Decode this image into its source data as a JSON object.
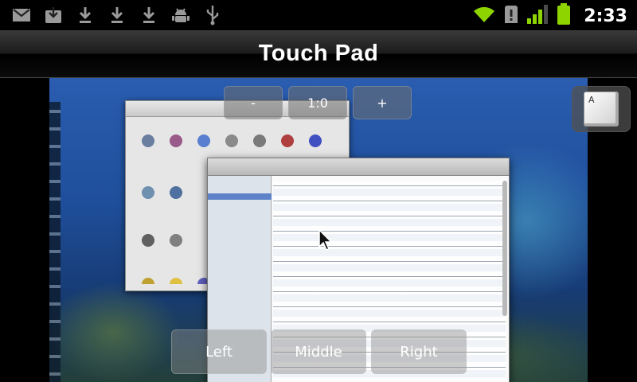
{
  "status_bar": {
    "notification_icons": [
      "gmail-icon",
      "download-box-icon",
      "download-icon",
      "download-icon",
      "download-icon",
      "android-debug-icon",
      "usb-icon"
    ],
    "system_icons": [
      "wifi-icon",
      "alert-icon",
      "signal-icon",
      "battery-icon"
    ],
    "time": "2:33"
  },
  "app": {
    "title": "Touch Pad"
  },
  "zoom": {
    "minus_label": "-",
    "ratio_label": "1:0",
    "plus_label": "+"
  },
  "keyboard_button": {
    "key_label": "A"
  },
  "mouse_buttons": {
    "left_label": "Left",
    "middle_label": "Middle",
    "right_label": "Right"
  },
  "colors": {
    "status_icon": "#9a9a9a",
    "wifi": "#8ed400",
    "battery": "#8ed400",
    "accent_blue": "#1f4f9c"
  }
}
